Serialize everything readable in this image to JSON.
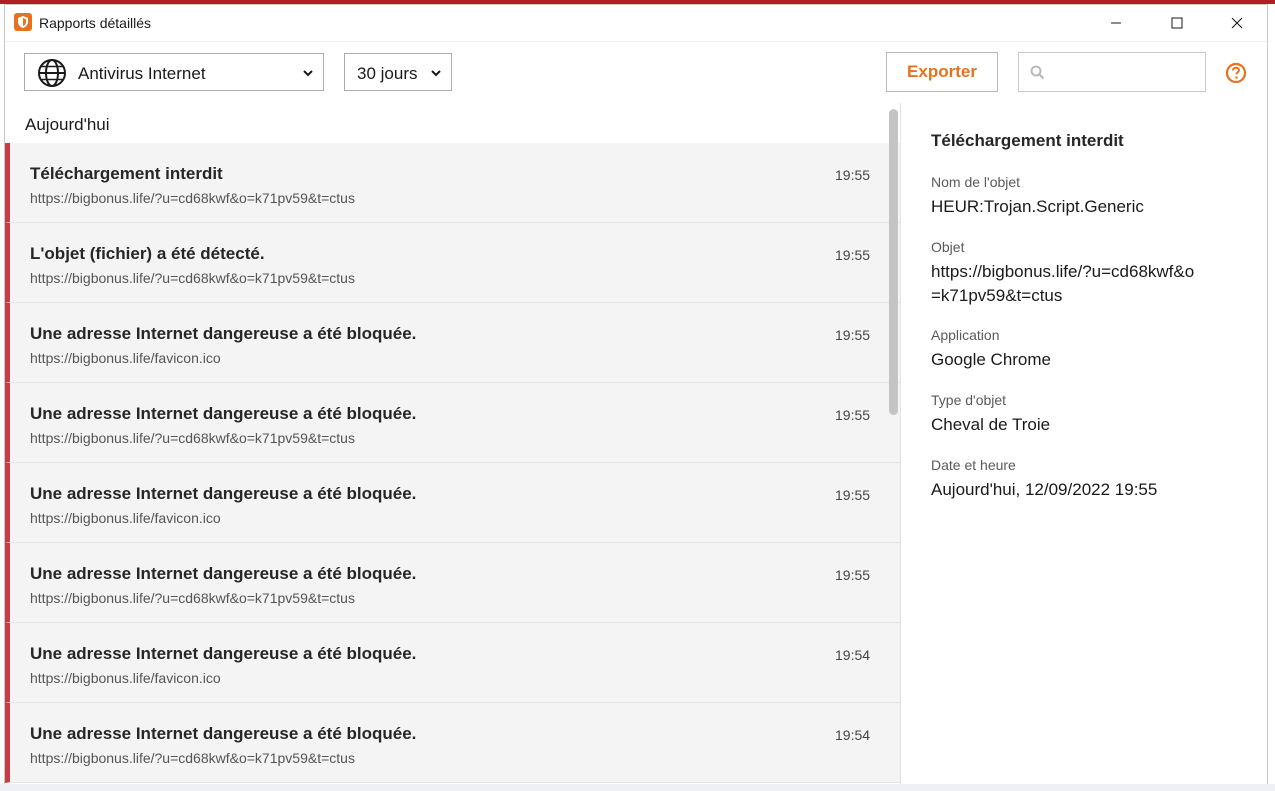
{
  "window": {
    "title": "Rapports détaillés",
    "accent_color": "#e8711c",
    "alert_color": "#c83c45"
  },
  "toolbar": {
    "component_dropdown": {
      "selected": "Antivirus Internet",
      "icon": "globe-icon"
    },
    "period_dropdown": {
      "selected": "30 jours"
    },
    "export_label": "Exporter",
    "search": {
      "placeholder": "",
      "value": ""
    },
    "help_icon": "help-circle-icon"
  },
  "list": {
    "group_label": "Aujourd'hui",
    "rows": [
      {
        "title": "Téléchargement interdit",
        "url": "https://bigbonus.life/?u=cd68kwf&o=k71pv59&t=ctus",
        "time": "19:55"
      },
      {
        "title": "L'objet (fichier) a été détecté.",
        "url": "https://bigbonus.life/?u=cd68kwf&o=k71pv59&t=ctus",
        "time": "19:55"
      },
      {
        "title": "Une adresse Internet dangereuse a été bloquée.",
        "url": "https://bigbonus.life/favicon.ico",
        "time": "19:55"
      },
      {
        "title": "Une adresse Internet dangereuse a été bloquée.",
        "url": "https://bigbonus.life/?u=cd68kwf&o=k71pv59&t=ctus",
        "time": "19:55"
      },
      {
        "title": "Une adresse Internet dangereuse a été bloquée.",
        "url": "https://bigbonus.life/favicon.ico",
        "time": "19:55"
      },
      {
        "title": "Une adresse Internet dangereuse a été bloquée.",
        "url": "https://bigbonus.life/?u=cd68kwf&o=k71pv59&t=ctus",
        "time": "19:55"
      },
      {
        "title": "Une adresse Internet dangereuse a été bloquée.",
        "url": "https://bigbonus.life/favicon.ico",
        "time": "19:54"
      },
      {
        "title": "Une adresse Internet dangereuse a été bloquée.",
        "url": "https://bigbonus.life/?u=cd68kwf&o=k71pv59&t=ctus",
        "time": "19:54"
      }
    ]
  },
  "details": {
    "title": "Téléchargement interdit",
    "fields": [
      {
        "label": "Nom de l'objet",
        "value": "HEUR:Trojan.Script.Generic"
      },
      {
        "label": "Objet",
        "value": "https://bigbonus.life/?u=cd68kwf&o=k71pv59&t=ctus"
      },
      {
        "label": "Application",
        "value": "Google Chrome"
      },
      {
        "label": "Type d'objet",
        "value": "Cheval de Troie"
      },
      {
        "label": "Date et heure",
        "value": "Aujourd'hui, 12/09/2022 19:55"
      }
    ]
  }
}
